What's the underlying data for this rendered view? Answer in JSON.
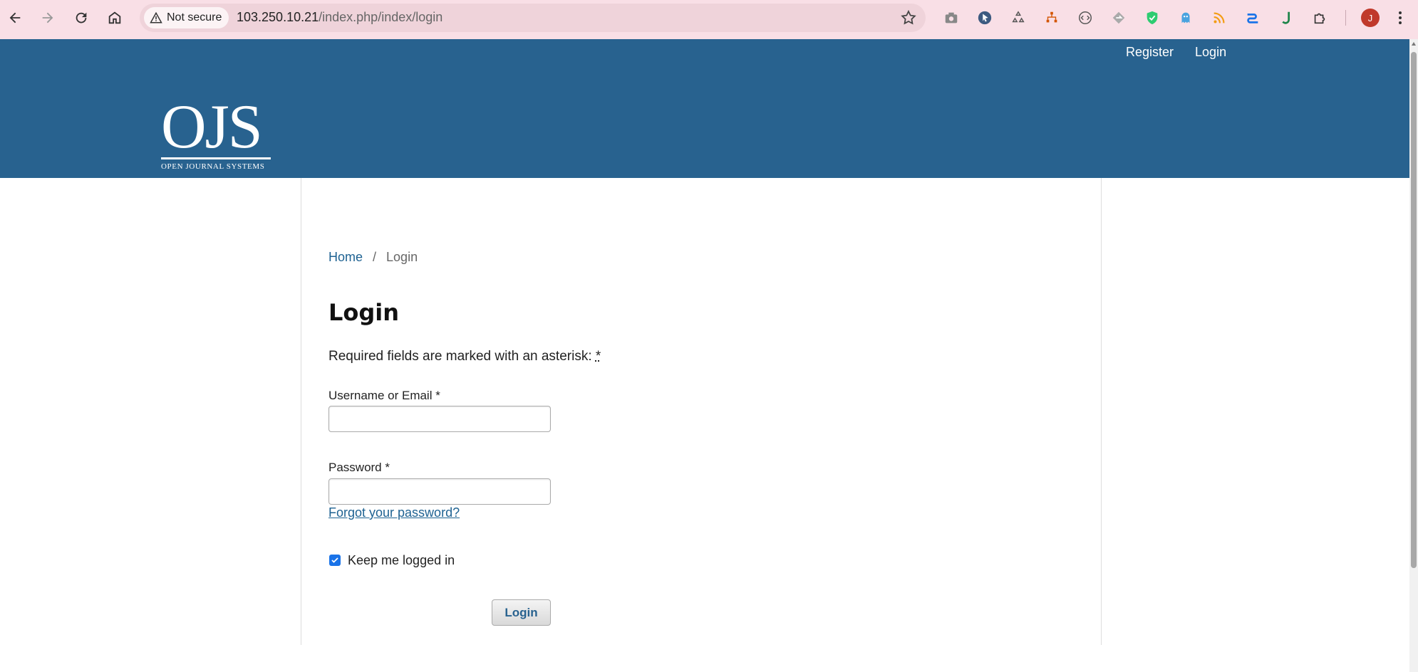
{
  "browser": {
    "security_label": "Not secure",
    "url_host": "103.250.10.21",
    "url_path": "/index.php/index/login",
    "profile_initial": "J"
  },
  "header": {
    "nav": {
      "register": "Register",
      "login": "Login"
    },
    "logo": {
      "mark": "OJS",
      "tagline": "OPEN JOURNAL SYSTEMS"
    }
  },
  "breadcrumb": {
    "home": "Home",
    "separator": "/",
    "current": "Login"
  },
  "form": {
    "title": "Login",
    "required_note": "Required fields are marked with an asterisk:",
    "required_marker": "*",
    "username_label": "Username or Email *",
    "username_value": "",
    "password_label": "Password *",
    "password_value": "",
    "forgot_link": "Forgot your password?",
    "remember_label": "Keep me logged in",
    "remember_checked": true,
    "submit_label": "Login"
  }
}
